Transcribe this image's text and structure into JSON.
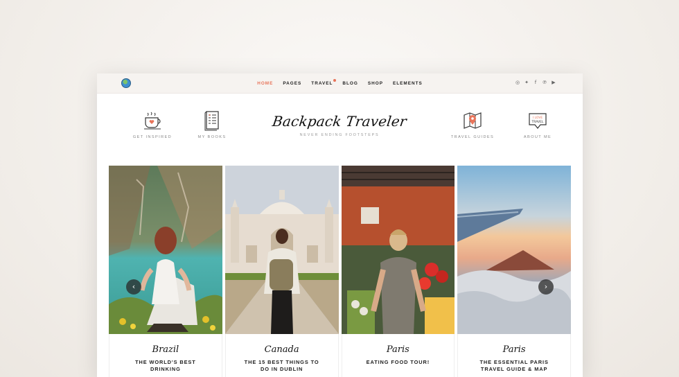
{
  "nav": {
    "items": [
      {
        "label": "HOME",
        "active": true
      },
      {
        "label": "PAGES"
      },
      {
        "label": "TRAVEL",
        "badge": true
      },
      {
        "label": "BLOG"
      },
      {
        "label": "SHOP"
      },
      {
        "label": "ELEMENTS"
      }
    ],
    "social": [
      "instagram-icon",
      "twitter-icon",
      "facebook-icon",
      "pinterest-icon",
      "youtube-icon"
    ]
  },
  "header": {
    "left_links": [
      {
        "label": "GET INSPIRED",
        "icon": "coffee-cup-icon"
      },
      {
        "label": "MY BOOKS",
        "icon": "notebook-icon"
      }
    ],
    "right_links": [
      {
        "label": "TRAVEL GUIDES",
        "icon": "map-pin-icon"
      },
      {
        "label": "ABOUT ME",
        "icon": "i-love-travel-icon"
      }
    ],
    "logo": "Backpack Traveler",
    "tagline": "NEVER ENDING FOOTSTEPS"
  },
  "cards": [
    {
      "city": "Brazil",
      "title": "THE WORLD'S BEST DRINKING"
    },
    {
      "city": "Canada",
      "title": "THE 15 BEST THINGS TO DO IN DUBLIN"
    },
    {
      "city": "Paris",
      "title": "EATING FOOD TOUR!"
    },
    {
      "city": "Paris",
      "title": "THE ESSENTIAL PARIS TRAVEL GUIDE & MAP"
    }
  ],
  "colors": {
    "accent": "#e8745a",
    "topbar": "#f6f3f0"
  }
}
